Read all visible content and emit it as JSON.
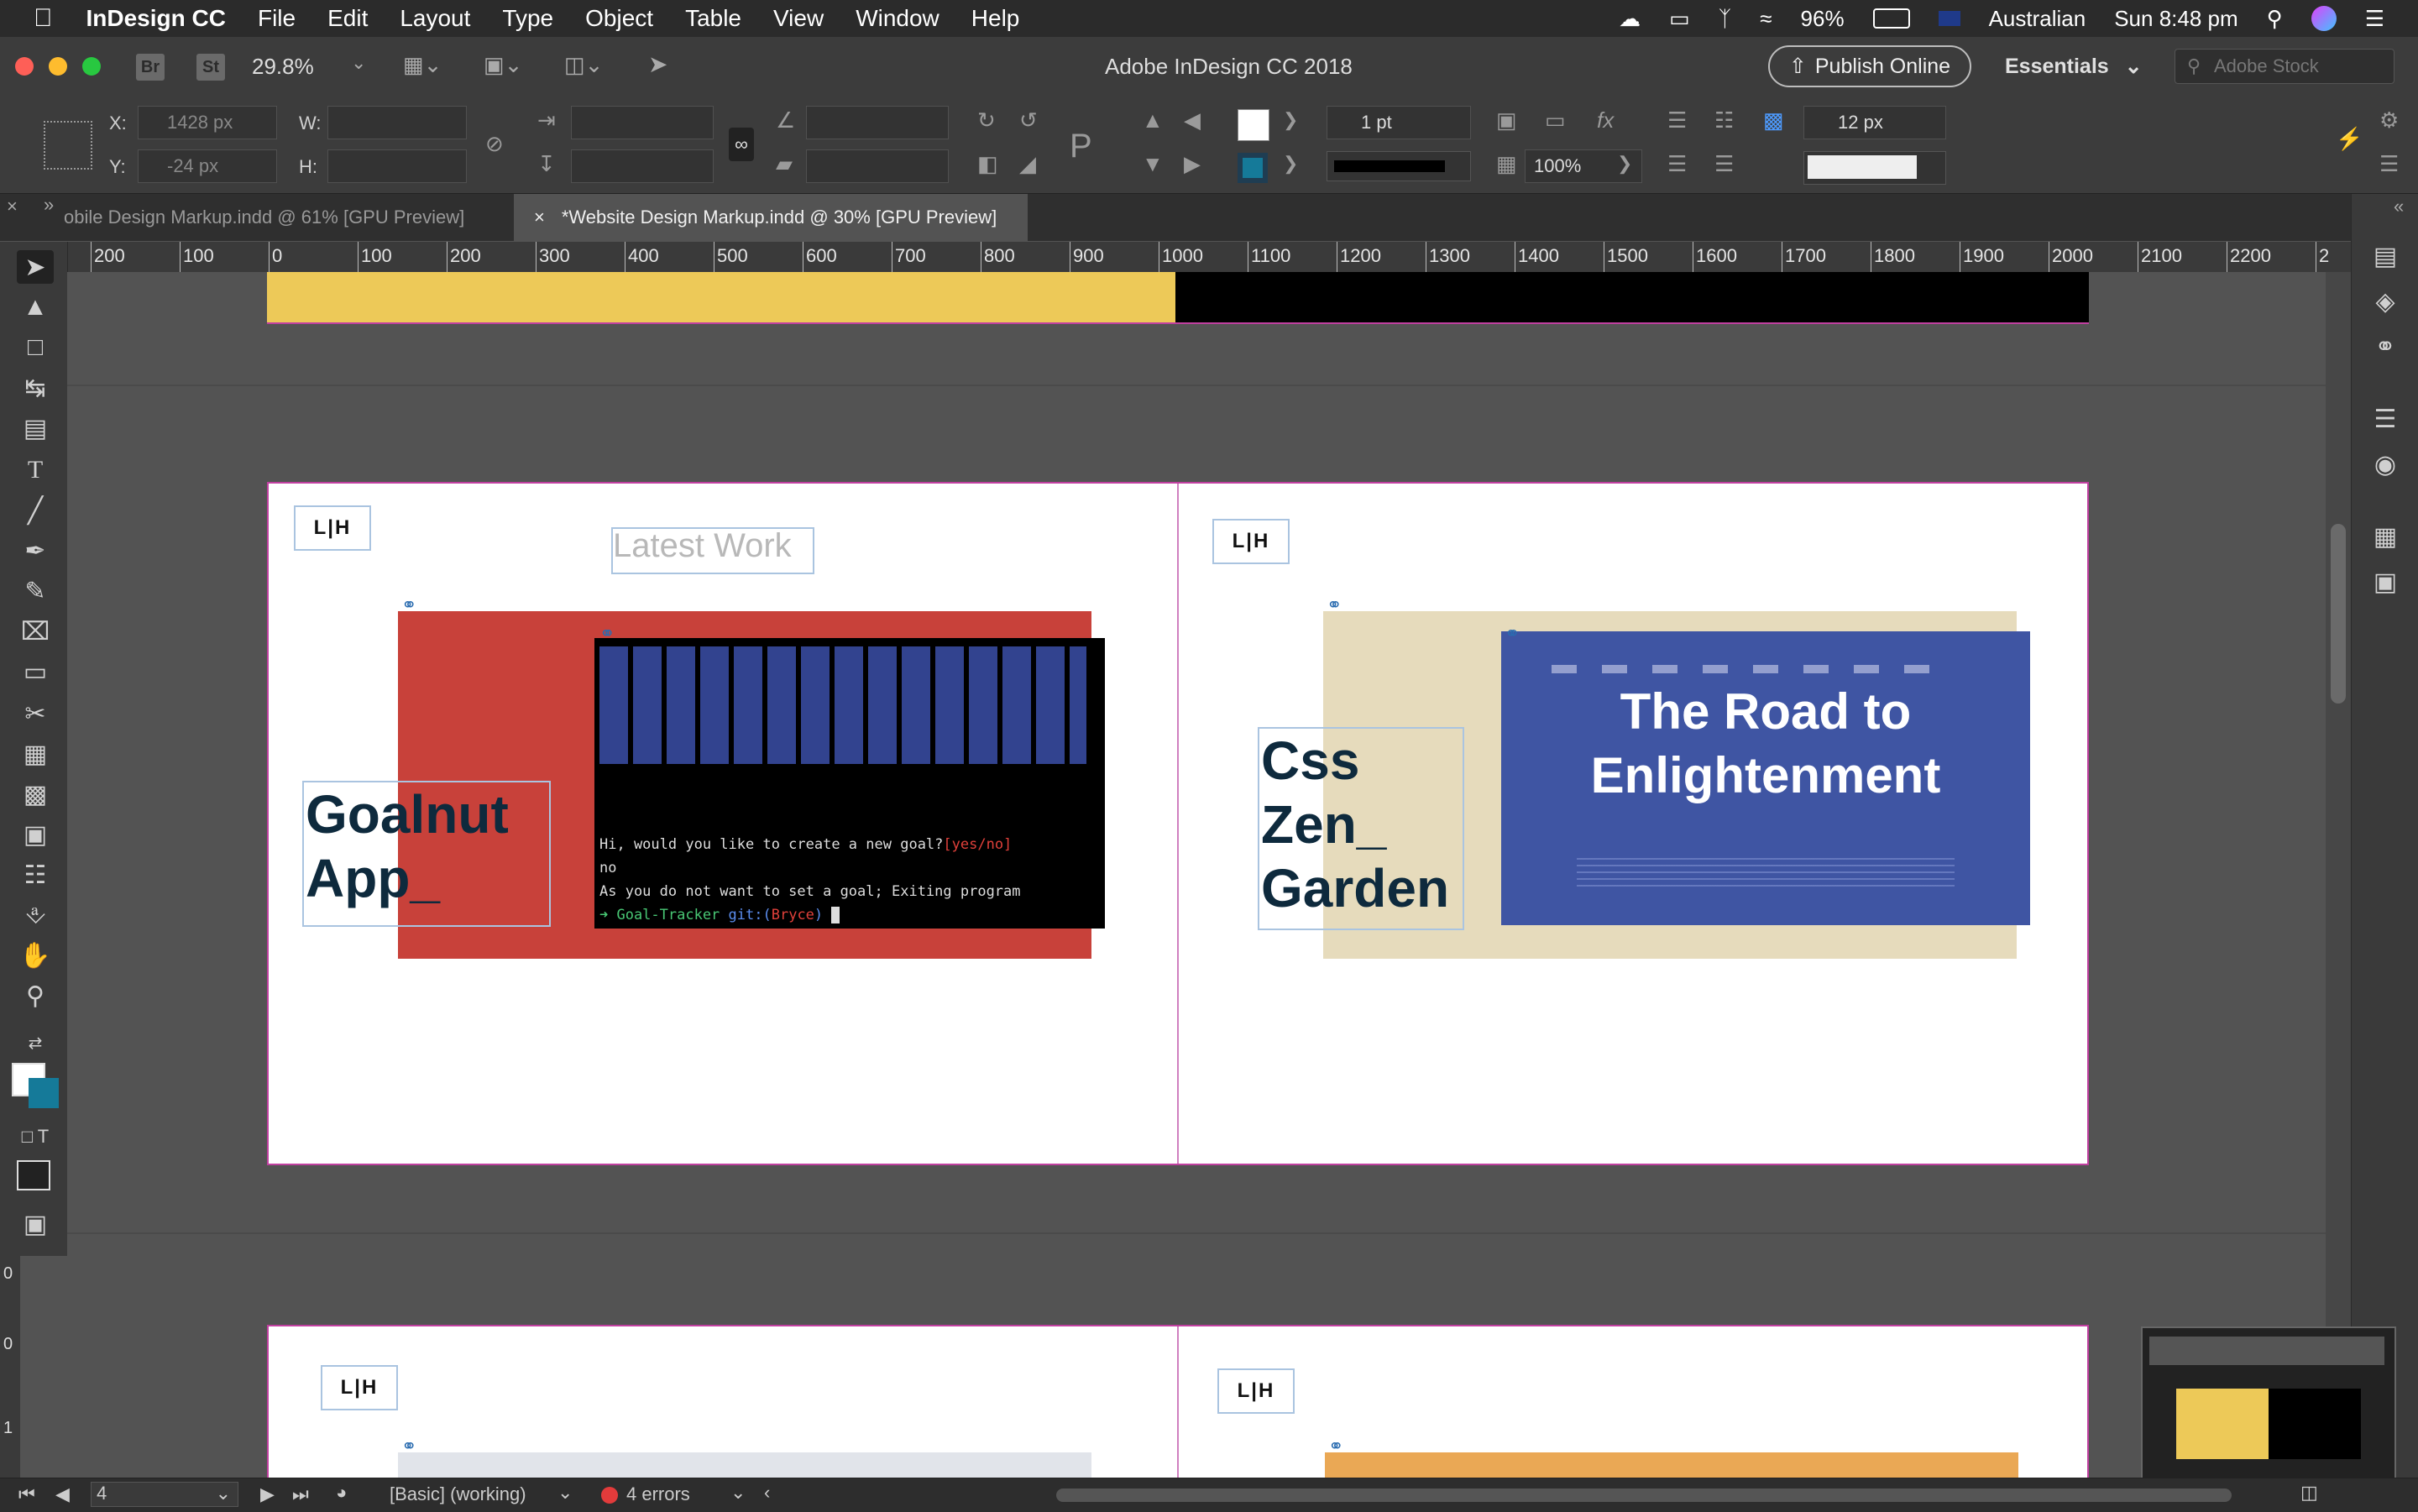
{
  "menubar": {
    "app_name": "InDesign CC",
    "items": [
      "File",
      "Edit",
      "Layout",
      "Type",
      "Object",
      "Table",
      "View",
      "Window",
      "Help"
    ],
    "battery": "96%",
    "input_source": "Australian",
    "clock": "Sun 8:48 pm"
  },
  "appbar": {
    "bridge_label": "Br",
    "stock_label": "St",
    "zoom": "29.8%",
    "window_title": "Adobe InDesign CC 2018",
    "publish_label": "Publish Online",
    "workspace": "Essentials",
    "search_placeholder": "Adobe Stock"
  },
  "control": {
    "x_label": "X:",
    "x_value": "1428 px",
    "y_label": "Y:",
    "y_value": "-24 px",
    "w_label": "W:",
    "h_label": "H:",
    "stroke_weight": "1 pt",
    "opacity": "100%",
    "gutter": "12 px"
  },
  "tabs": [
    {
      "label": "obile Design Markup.indd @ 61% [GPU Preview]"
    },
    {
      "label": "*Website Design Markup.indd @ 30% [GPU Preview]"
    }
  ],
  "ruler_ticks": [
    "200",
    "100",
    "0",
    "100",
    "200",
    "300",
    "400",
    "500",
    "600",
    "700",
    "800",
    "900",
    "1000",
    "1100",
    "1200",
    "1300",
    "1400",
    "1500",
    "1600",
    "1700",
    "1800",
    "1900",
    "2000",
    "2100",
    "2200",
    "2"
  ],
  "vruler_ticks": [
    "0",
    "0",
    "1",
    "0",
    "0"
  ],
  "document": {
    "logo_text": "L|H",
    "section_heading": "Latest Work",
    "project1_title_line1": "Goalnut",
    "project1_title_line2": "App_",
    "terminal_line1": "Hi, would you like to create a new goal?",
    "terminal_prompt_opts": "[yes/no]",
    "terminal_line2": "no",
    "terminal_line3": "As you do not want to set a goal; Exiting program",
    "terminal_prompt": "➜ Goal-Tracker",
    "terminal_git": "git:(",
    "terminal_branch": "Bryce",
    "terminal_close": ")",
    "project2_title_line1": "Css",
    "project2_title_line2": "Zen_",
    "project2_title_line3": "Garden",
    "zen_heading_line1": "The Road to",
    "zen_heading_line2": "Enlightenment"
  },
  "statusbar": {
    "page_number": "4",
    "preflight_profile": "[Basic] (working)",
    "errors": "4 errors"
  },
  "colors": {
    "accent_yellow": "#edc958",
    "goalnut_red": "#c8413a",
    "zen_beige": "#e6dbbc",
    "zen_blue": "#3f55a3",
    "title_navy": "#0e2a3d"
  }
}
